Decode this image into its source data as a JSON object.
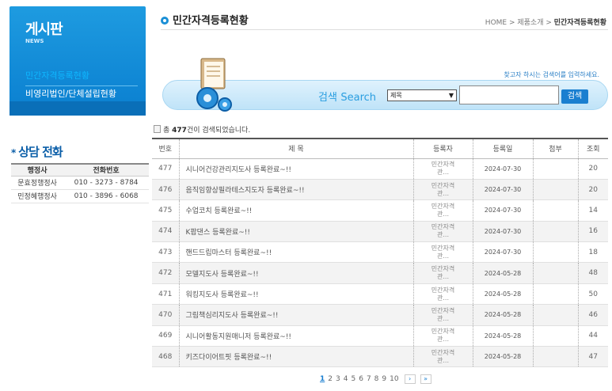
{
  "sidebar": {
    "title": "게시판",
    "subtitle": "NEWS",
    "items": [
      {
        "label": "민간자격등록현황",
        "active": true
      },
      {
        "label": "비영리법인/단체설립현황",
        "active": false
      }
    ]
  },
  "consult": {
    "title": "상담 전화",
    "star": "*",
    "headers": [
      "행정사",
      "전화번호"
    ],
    "rows": [
      [
        "문효정행정사",
        "010 - 3273 - 8784"
      ],
      [
        "민정혜행정사",
        "010 - 3896 - 6068"
      ]
    ]
  },
  "header": {
    "title": "민간자격등록현황",
    "breadcrumb_prefix": "HOME > 제품소개 > ",
    "breadcrumb_current": "민간자격등록현황"
  },
  "search": {
    "hint": "찾고자 하시는 검색어를 입력하세요.",
    "label_ko": "검색",
    "label_en": "Search",
    "select_value": "제목",
    "input_value": "",
    "button_label": "검색"
  },
  "results": {
    "prefix": "총 ",
    "count": "477",
    "suffix": "건이 검색되었습니다."
  },
  "board": {
    "headers": [
      "번호",
      "제  목",
      "등록자",
      "등록일",
      "첨부",
      "조회"
    ],
    "rows": [
      {
        "num": "477",
        "title": "시니어건강관리지도사 등록완료~!!",
        "author": "민간자격\n관...",
        "date": "2024-07-30",
        "attach": "",
        "views": "20"
      },
      {
        "num": "476",
        "title": "음직임향상필라테스지도자 등록완료~!!",
        "author": "민간자격\n관...",
        "date": "2024-07-30",
        "attach": "",
        "views": "20"
      },
      {
        "num": "475",
        "title": "수업코치 등록완료~!!",
        "author": "민간자격\n관...",
        "date": "2024-07-30",
        "attach": "",
        "views": "14"
      },
      {
        "num": "474",
        "title": "K팝댄스 등록완료~!!",
        "author": "민간자격\n관...",
        "date": "2024-07-30",
        "attach": "",
        "views": "16"
      },
      {
        "num": "473",
        "title": "핸드드립마스터 등록완료~!!",
        "author": "민간자격\n관...",
        "date": "2024-07-30",
        "attach": "",
        "views": "18"
      },
      {
        "num": "472",
        "title": "모델지도사 등록완료~!!",
        "author": "민간자격\n관...",
        "date": "2024-05-28",
        "attach": "",
        "views": "48"
      },
      {
        "num": "471",
        "title": "워킹지도사 등록완료~!!",
        "author": "민간자격\n관...",
        "date": "2024-05-28",
        "attach": "",
        "views": "50"
      },
      {
        "num": "470",
        "title": "그림책심리지도사 등록완료~!!",
        "author": "민간자격\n관...",
        "date": "2024-05-28",
        "attach": "",
        "views": "46"
      },
      {
        "num": "469",
        "title": "시니어활동지원매니저 등록완료~!!",
        "author": "민간자격\n관...",
        "date": "2024-05-28",
        "attach": "",
        "views": "44"
      },
      {
        "num": "468",
        "title": "키즈다이어트핏 등록완료~!!",
        "author": "민간자격\n관...",
        "date": "2024-05-28",
        "attach": "",
        "views": "47"
      }
    ]
  },
  "pager": {
    "pages": [
      "1",
      "2",
      "3",
      "4",
      "5",
      "6",
      "7",
      "8",
      "9",
      "10"
    ],
    "current": "1",
    "next": "›",
    "last": "»"
  },
  "colors": {
    "brand_blue": "#0a7fd0",
    "accent_light": "#0fb7ff"
  }
}
